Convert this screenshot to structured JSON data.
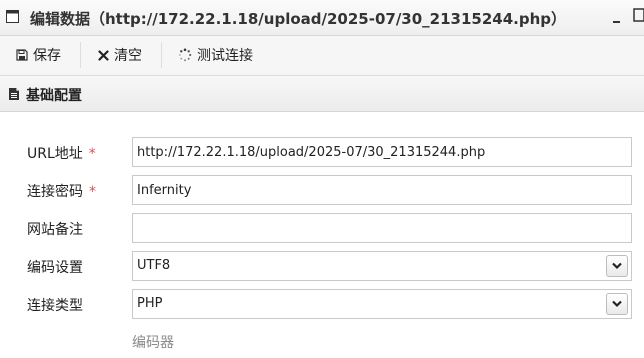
{
  "window": {
    "title": "编辑数据（http://172.22.1.18/upload/2025-07/30_21315244.php）",
    "title_icon": "window-icon",
    "minimize_icon": "minimize-icon",
    "close_icon": "close-icon"
  },
  "toolbar": {
    "save_label": "保存",
    "save_icon": "save-icon",
    "clear_label": "清空",
    "clear_icon": "x-icon",
    "test_label": "测试连接",
    "test_icon": "spinner-icon"
  },
  "section": {
    "title": "基础配置",
    "icon": "document-icon"
  },
  "form": {
    "url": {
      "label": "URL地址",
      "required_mark": "*",
      "value": "http://172.22.1.18/upload/2025-07/30_21315244.php"
    },
    "password": {
      "label": "连接密码",
      "required_mark": "*",
      "value": "Infernity"
    },
    "note": {
      "label": "网站备注",
      "value": ""
    },
    "encoding": {
      "label": "编码设置",
      "selected": "UTF8"
    },
    "type": {
      "label": "连接类型",
      "selected": "PHP"
    },
    "encoder_label": "编码器"
  },
  "colors": {
    "required": "#d9534f",
    "toolbar_bg": "#f6f6f6",
    "header_bg": "#ececec",
    "muted_text": "#8a8a8a"
  }
}
